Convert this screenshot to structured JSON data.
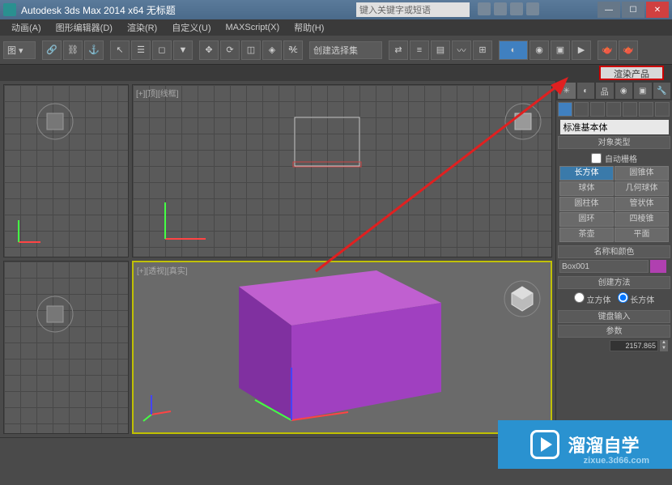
{
  "title": "Autodesk 3ds Max  2014 x64     无标题",
  "search_placeholder": "键入关键字或短语",
  "menu": {
    "animation": "动画(A)",
    "graph_editors": "图形编辑器(D)",
    "rendering": "渲染(R)",
    "customize": "自定义(U)",
    "maxscript": "MAXScript(X)",
    "help": "帮助(H)"
  },
  "toolbar": {
    "view_dropdown": "图 ▾",
    "selection_set": "创建选择集"
  },
  "render_button": "渲染产品",
  "viewports": {
    "top_label": "[+][顶][线框]",
    "persp_label": "[+][透视][真实]"
  },
  "panel": {
    "primitive_dropdown": "标准基本体",
    "rollouts": {
      "object_type": "对象类型",
      "auto_grid": "自动栅格",
      "name_color": "名称和颜色",
      "creation_method": "创建方法",
      "keyboard_entry": "键盘输入",
      "parameters": "参数"
    },
    "geometry": {
      "box": "长方体",
      "cone": "圆锥体",
      "sphere": "球体",
      "geosphere": "几何球体",
      "cylinder": "圆柱体",
      "tube": "管状体",
      "torus": "圆环",
      "pyramid": "四棱锥",
      "teapot": "茶壶",
      "plane": "平面"
    },
    "object_name": "Box001",
    "creation": {
      "cube": "立方体",
      "box": "长方体"
    },
    "param_value": "2157.865"
  },
  "watermark": {
    "brand": "溜溜自学",
    "url": "zixue.3d66.com"
  }
}
